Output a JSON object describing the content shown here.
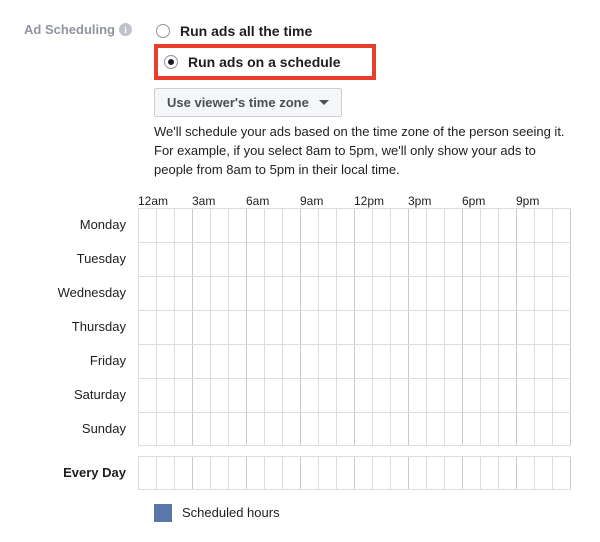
{
  "section": {
    "label": "Ad Scheduling"
  },
  "options": {
    "all_time": {
      "label": "Run ads all the time",
      "selected": false
    },
    "schedule": {
      "label": "Run ads on a schedule",
      "selected": true
    }
  },
  "timezone_dropdown": {
    "label": "Use viewer's time zone"
  },
  "help": {
    "line1": "We'll schedule your ads based on the time zone of the person seeing it.",
    "line2": "For example, if you select 8am to 5pm, we'll only show your ads to people from 8am to 5pm in their local time."
  },
  "time_headers": [
    "12am",
    "3am",
    "6am",
    "9am",
    "12pm",
    "3pm",
    "6pm",
    "9pm"
  ],
  "days": [
    "Monday",
    "Tuesday",
    "Wednesday",
    "Thursday",
    "Friday",
    "Saturday",
    "Sunday"
  ],
  "every_day_label": "Every Day",
  "legend": {
    "scheduled": "Scheduled hours"
  },
  "colors": {
    "highlight": "#e83d2a",
    "legend_fill": "#5a77a9"
  }
}
